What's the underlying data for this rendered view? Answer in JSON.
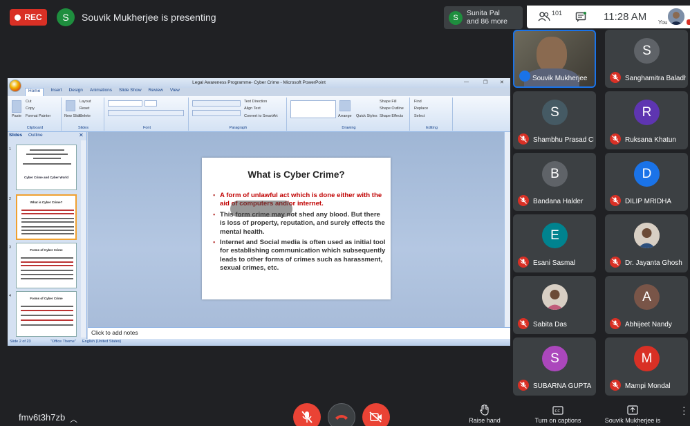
{
  "topbar": {
    "rec_label": "REC",
    "presenter_initial": "S",
    "presenting_text": "Souvik Mukherjee is presenting",
    "others_initial": "S",
    "others_name": "Sunita Pal",
    "others_more": "and 86 more",
    "participant_count": "101",
    "time": "11:28 AM",
    "you_label": "You"
  },
  "powerpoint": {
    "title": "Legal Awareness Programme- Cyber Crime - Microsoft PowerPoint",
    "tabs": [
      "Home",
      "Insert",
      "Design",
      "Animations",
      "Slide Show",
      "Review",
      "View"
    ],
    "ribbon_groups": [
      "Clipboard",
      "Slides",
      "Font",
      "Paragraph",
      "Drawing",
      "Editing"
    ],
    "clipboard": {
      "cut": "Cut",
      "copy": "Copy",
      "paste": "Paste",
      "format_painter": "Format Painter"
    },
    "slides_group": {
      "new_slide": "New Slide",
      "layout": "Layout",
      "reset": "Reset",
      "delete": "Delete"
    },
    "paragraph": {
      "text_direction": "Text Direction",
      "align_text": "Align Text",
      "convert": "Convert to SmartArt"
    },
    "drawing": {
      "arrange": "Arrange",
      "quick_styles": "Quick Styles",
      "shape_fill": "Shape Fill",
      "shape_outline": "Shape Outline",
      "shape_effects": "Shape Effects"
    },
    "editing": {
      "find": "Find",
      "replace": "Replace",
      "select": "Select"
    },
    "left_tabs": {
      "slides": "Slides",
      "outline": "Outline"
    },
    "thumbnails": [
      {
        "num": "1",
        "title": "Cyber Crime and Cyber World"
      },
      {
        "num": "2",
        "title": "What is Cyber Crime?"
      },
      {
        "num": "3",
        "title": "Forms of Cyber Crime"
      },
      {
        "num": "4",
        "title": "Forms of Cyber Crime"
      }
    ],
    "slide": {
      "heading": "What is Cyber Crime?",
      "bullets": [
        "A form of unlawful act which is done either with the aid of computers and/or internet.",
        "This form crime may not shed any blood. But there is loss of property, reputation, and surely effects the mental health.",
        "Internet and Social media is often used as initial tool for establishing communication which subsequently leads to other forms of crimes such as harassment, sexual crimes, etc."
      ]
    },
    "notes_placeholder": "Click to add notes",
    "status": {
      "slide_pos": "Slide 2 of 23",
      "theme": "\"Office Theme\"",
      "language": "English (United States)"
    }
  },
  "participants": [
    {
      "name": "Souvik Mukherjee",
      "type": "video"
    },
    {
      "name": "Sanghamitra Baladhi...",
      "initial": "S",
      "color": "#5f6368"
    },
    {
      "name": "Shambhu Prasad Ch...",
      "initial": "S",
      "color": "#455a64"
    },
    {
      "name": "Ruksana Khatun",
      "initial": "R",
      "color": "#5e35b1"
    },
    {
      "name": "Bandana Halder",
      "initial": "B",
      "color": "#5f6368"
    },
    {
      "name": "DILIP MRIDHA",
      "initial": "D",
      "color": "#1a73e8"
    },
    {
      "name": "Esani Sasmal",
      "initial": "E",
      "color": "#00838f"
    },
    {
      "name": "Dr. Jayanta Ghosh",
      "type": "photo"
    },
    {
      "name": "Sabita Das",
      "type": "photo"
    },
    {
      "name": "Abhijeet Nandy",
      "initial": "A",
      "color": "#795548"
    },
    {
      "name": "SUBARNA GUPTA",
      "initial": "S",
      "color": "#ab47bc"
    },
    {
      "name": "Mampi Mondal",
      "initial": "M",
      "color": "#d93025"
    }
  ],
  "bottombar": {
    "meeting_code": "fmv6t3h7zb",
    "raise_hand": "Raise hand",
    "captions": "Turn on captions",
    "presenting": "Souvik Mukherjee is presenting"
  }
}
